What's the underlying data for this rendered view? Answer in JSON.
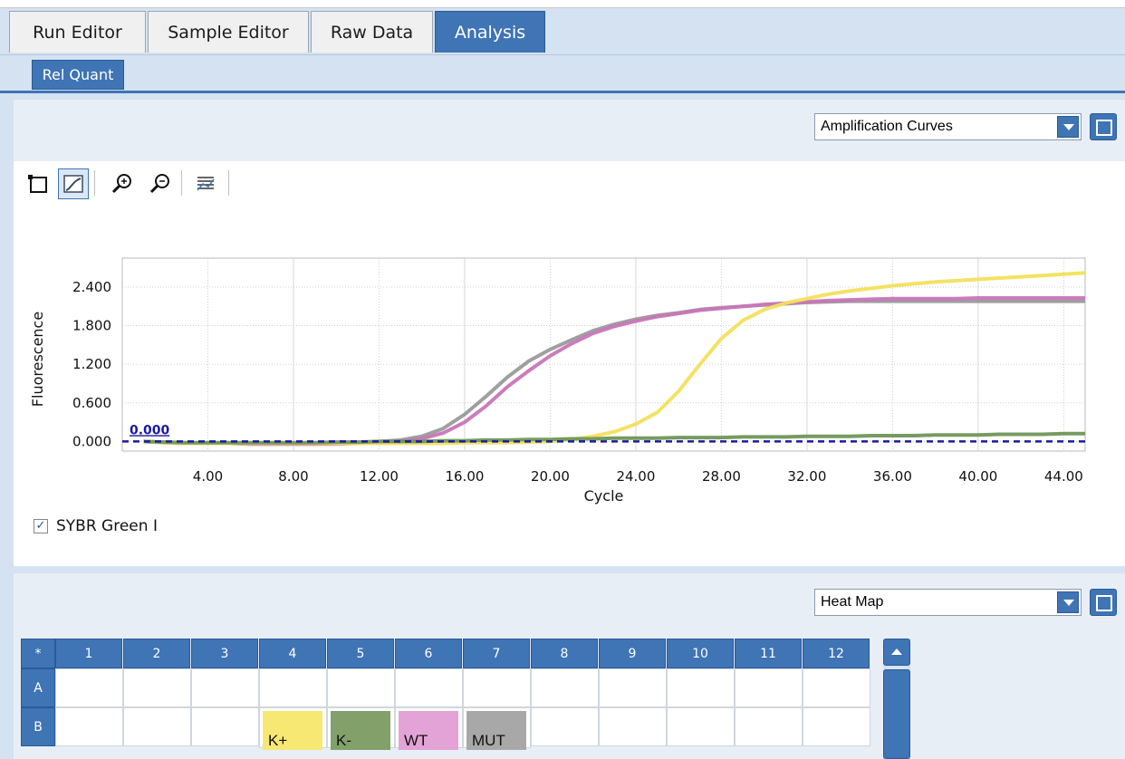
{
  "tabs": [
    {
      "label": "Run Editor",
      "active": false
    },
    {
      "label": "Sample Editor",
      "active": false
    },
    {
      "label": "Raw Data",
      "active": false
    },
    {
      "label": "Analysis",
      "active": true
    }
  ],
  "subtab": {
    "label": "Rel Quant"
  },
  "chart_panel": {
    "view_select": "Amplification Curves",
    "checkbox_label": "SYBR Green I",
    "checkbox_checked": true,
    "toolbar": [
      "select-icon",
      "fit-view-icon",
      "zoom-in-icon",
      "zoom-out-icon",
      "legend-icon"
    ]
  },
  "heat_panel": {
    "view_select": "Heat Map",
    "corner": "*",
    "columns": [
      "1",
      "2",
      "3",
      "4",
      "5",
      "6",
      "7",
      "8",
      "9",
      "10",
      "11",
      "12"
    ],
    "rows": [
      {
        "label": "A",
        "wells": {}
      },
      {
        "label": "B",
        "wells": {
          "4": "K+",
          "5": "K-",
          "6": "WT",
          "7": "MUT"
        }
      }
    ],
    "well_colors": {
      "K+": "#f7e874",
      "K-": "#82a06a",
      "WT": "#e4a3d6",
      "MUT": "#a8a8a8"
    }
  },
  "chart_data": {
    "type": "line",
    "title": "",
    "xlabel": "Cycle",
    "ylabel": "Fluorescence",
    "xlim": [
      0,
      45
    ],
    "ylim": [
      -0.15,
      2.85
    ],
    "xticks": [
      "4.00",
      "8.00",
      "12.00",
      "16.00",
      "20.00",
      "24.00",
      "28.00",
      "32.00",
      "36.00",
      "40.00",
      "44.00"
    ],
    "yticks": [
      "0.000",
      "0.600",
      "1.200",
      "1.800",
      "2.400"
    ],
    "threshold": {
      "value": 0.0,
      "label": "0.000",
      "color": "#1a1a9e"
    },
    "x": [
      1,
      2,
      3,
      4,
      5,
      6,
      7,
      8,
      9,
      10,
      11,
      12,
      13,
      14,
      15,
      16,
      17,
      18,
      19,
      20,
      21,
      22,
      23,
      24,
      25,
      26,
      27,
      28,
      29,
      30,
      31,
      32,
      33,
      34,
      35,
      36,
      37,
      38,
      39,
      40,
      41,
      42,
      43,
      44,
      45
    ],
    "series": [
      {
        "color": "#9a9a9a",
        "values": [
          0,
          -0.02,
          -0.03,
          -0.03,
          -0.03,
          -0.04,
          -0.04,
          -0.04,
          -0.04,
          -0.03,
          -0.02,
          0,
          0.02,
          0.08,
          0.2,
          0.42,
          0.7,
          1.0,
          1.25,
          1.43,
          1.58,
          1.72,
          1.82,
          1.9,
          1.96,
          2.0,
          2.05,
          2.08,
          2.1,
          2.12,
          2.14,
          2.16,
          2.17,
          2.18,
          2.18,
          2.18,
          2.18,
          2.18,
          2.18,
          2.18,
          2.18,
          2.18,
          2.18,
          2.18,
          2.18
        ]
      },
      {
        "color": "#c975b8",
        "values": [
          0,
          -0.02,
          -0.03,
          -0.03,
          -0.03,
          -0.04,
          -0.04,
          -0.04,
          -0.04,
          -0.04,
          -0.03,
          -0.02,
          0,
          0.04,
          0.13,
          0.3,
          0.55,
          0.85,
          1.1,
          1.33,
          1.52,
          1.68,
          1.79,
          1.87,
          1.94,
          1.99,
          2.04,
          2.07,
          2.1,
          2.13,
          2.15,
          2.17,
          2.19,
          2.2,
          2.21,
          2.22,
          2.22,
          2.22,
          2.22,
          2.23,
          2.23,
          2.23,
          2.23,
          2.23,
          2.23
        ]
      },
      {
        "color": "#f2e05c",
        "values": [
          0,
          -0.02,
          -0.03,
          -0.03,
          -0.03,
          -0.03,
          -0.03,
          -0.03,
          -0.03,
          -0.03,
          -0.03,
          -0.03,
          -0.03,
          -0.03,
          -0.03,
          -0.02,
          -0.02,
          -0.02,
          -0.01,
          0,
          0.03,
          0.08,
          0.15,
          0.27,
          0.45,
          0.78,
          1.2,
          1.6,
          1.88,
          2.05,
          2.15,
          2.22,
          2.29,
          2.34,
          2.38,
          2.42,
          2.45,
          2.48,
          2.5,
          2.52,
          2.54,
          2.56,
          2.58,
          2.6,
          2.62
        ]
      },
      {
        "color": "#6f9657",
        "values": [
          0,
          -0.01,
          -0.02,
          -0.02,
          -0.02,
          -0.02,
          -0.02,
          -0.02,
          -0.02,
          -0.01,
          -0.01,
          0,
          0,
          0,
          0.01,
          0.01,
          0.02,
          0.02,
          0.03,
          0.03,
          0.04,
          0.04,
          0.05,
          0.05,
          0.05,
          0.06,
          0.06,
          0.06,
          0.07,
          0.07,
          0.07,
          0.08,
          0.08,
          0.08,
          0.09,
          0.09,
          0.09,
          0.1,
          0.1,
          0.1,
          0.11,
          0.11,
          0.11,
          0.12,
          0.12
        ]
      }
    ]
  }
}
